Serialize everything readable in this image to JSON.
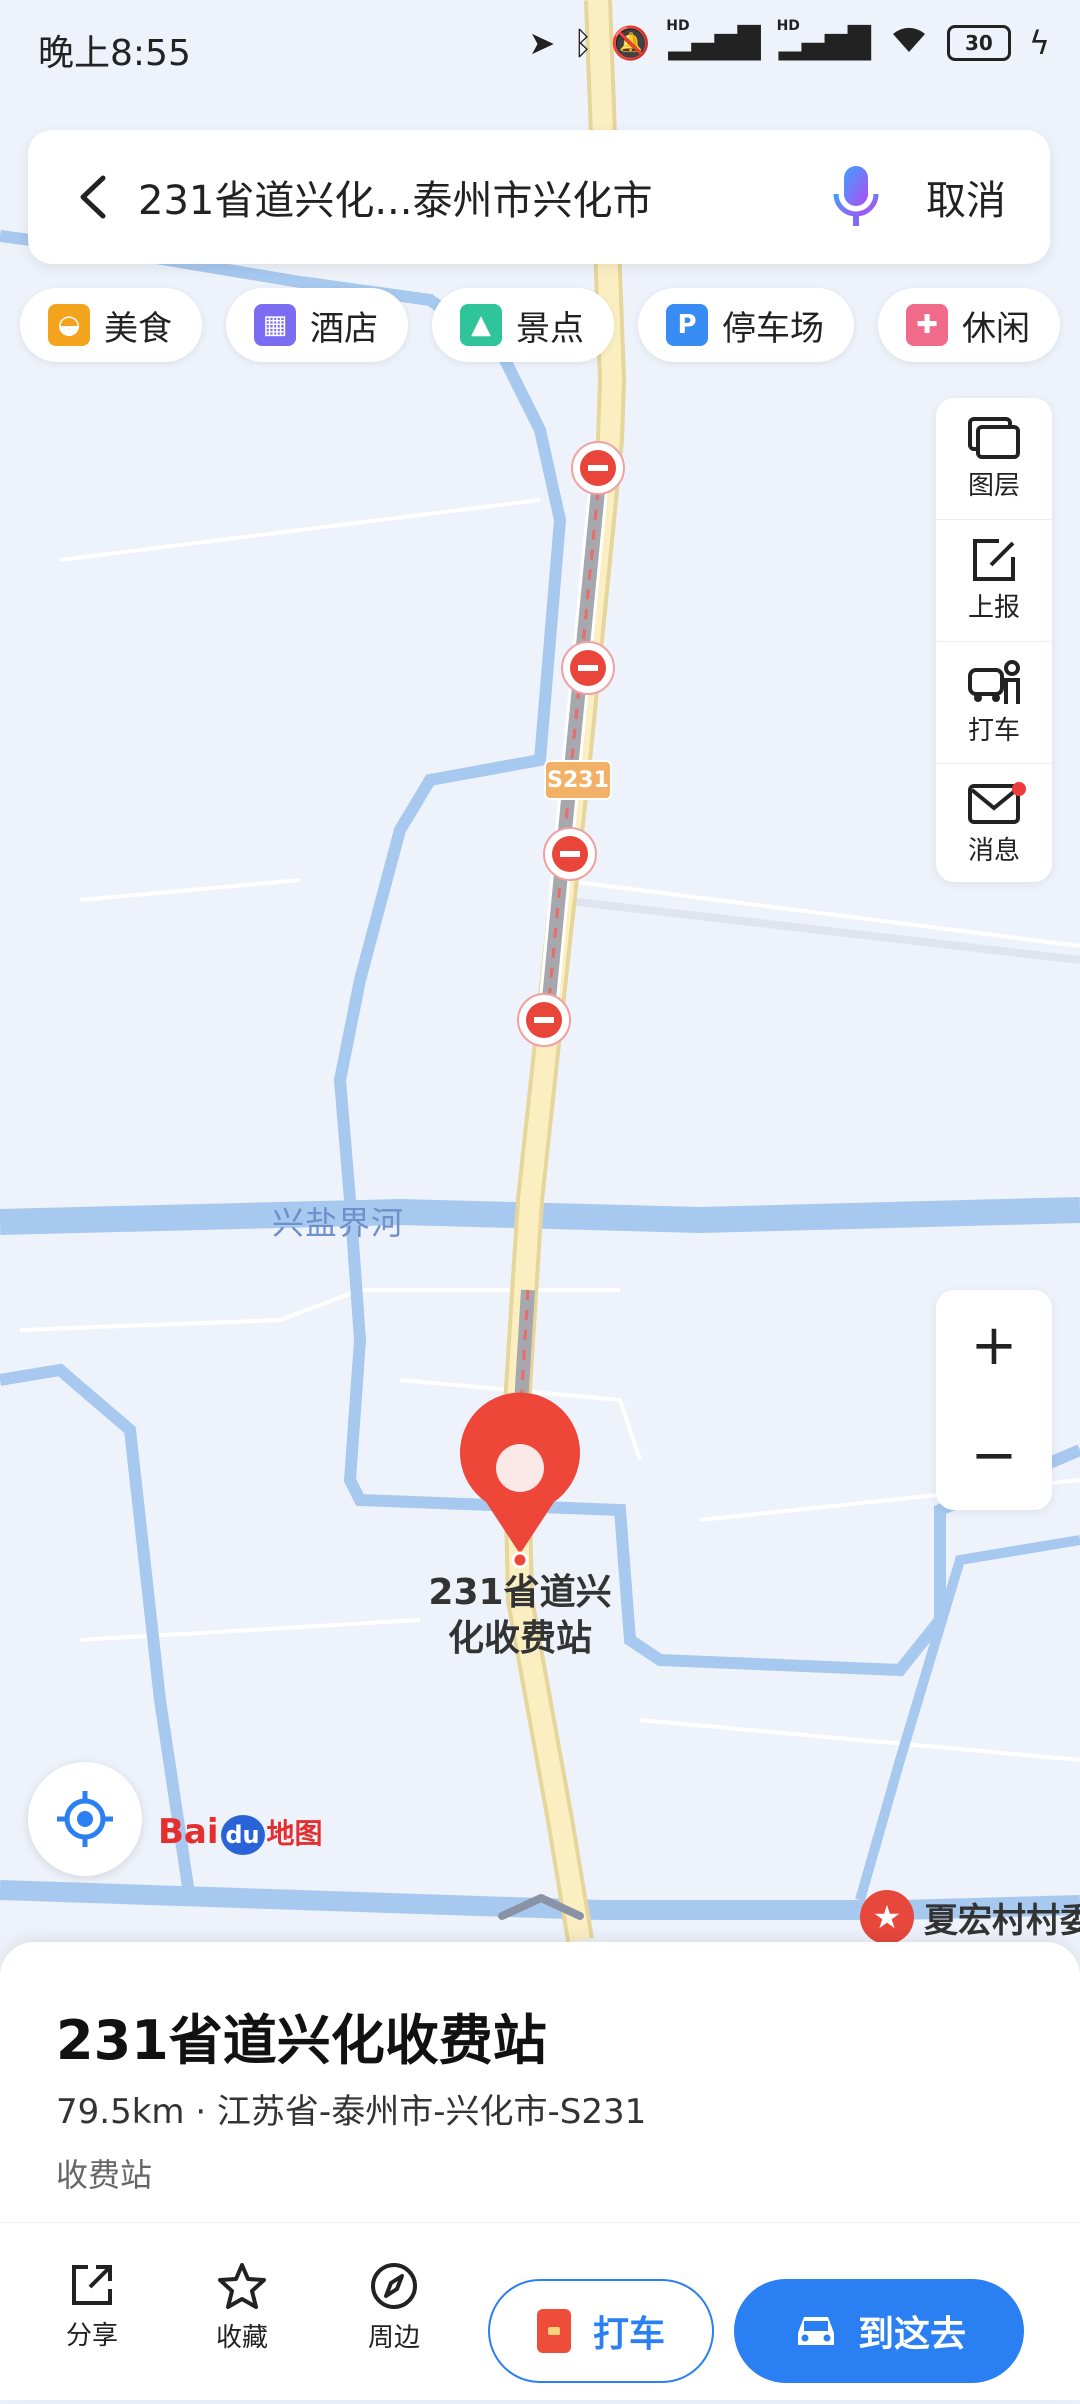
{
  "status_bar": {
    "time": "晚上8:55",
    "battery": "30",
    "hd": "HD"
  },
  "search": {
    "query": "231省道兴化...泰州市兴化市",
    "cancel_label": "取消"
  },
  "chips": [
    {
      "label": "美食",
      "icon": "food-icon",
      "color": "#f4a41c"
    },
    {
      "label": "酒店",
      "icon": "hotel-icon",
      "color": "#7b6cf2"
    },
    {
      "label": "景点",
      "icon": "scenic-icon",
      "color": "#2fc49a"
    },
    {
      "label": "停车场",
      "icon": "parking-icon",
      "color": "#3a8cf5"
    },
    {
      "label": "休闲",
      "icon": "leisure-icon",
      "color": "#f26a8a"
    }
  ],
  "toolbar": {
    "layers": "图层",
    "report": "上报",
    "taxi": "打车",
    "messages": "消息"
  },
  "map": {
    "road_shield": "S231",
    "river_name": "兴盐界河",
    "poi_label": "231省道兴化收费站",
    "partial_poi": "夏宏村村委",
    "logo_bai": "Bai",
    "logo_du": "du",
    "logo_map": "地图"
  },
  "zoom": {
    "in": "+",
    "out": "−"
  },
  "poi": {
    "name": "231省道兴化收费站",
    "distance_line": "79.5km · 江苏省-泰州市-兴化市-S231",
    "category": "收费站"
  },
  "actions": {
    "share": "分享",
    "favorite": "收藏",
    "nearby": "周边",
    "taxi": "打车",
    "go": "到这去"
  },
  "colors": {
    "accent": "#2a7ff2",
    "marker": "#ee4638",
    "water": "#a7c8ef",
    "road": "#f7e8b4"
  }
}
